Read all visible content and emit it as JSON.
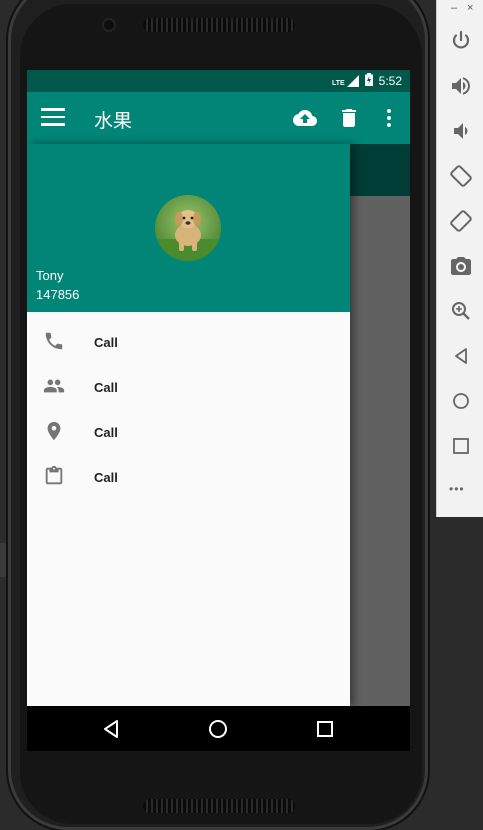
{
  "status_bar": {
    "network": "LTE",
    "time": "5:52"
  },
  "toolbar": {
    "title": "水果"
  },
  "drawer": {
    "user_name": "Tony",
    "user_phone": "147856",
    "items": [
      {
        "icon": "phone-icon",
        "label": "Call"
      },
      {
        "icon": "friends-icon",
        "label": "Call"
      },
      {
        "icon": "location-icon",
        "label": "Call"
      },
      {
        "icon": "task-icon",
        "label": "Call"
      }
    ]
  },
  "emulator_panel": {
    "minimize": "–",
    "close": "×",
    "more": "•••"
  },
  "colors": {
    "primary": "#008577",
    "primary_dark": "#00574b",
    "drawer_bg": "#fafafa",
    "scrim": "#616161"
  }
}
